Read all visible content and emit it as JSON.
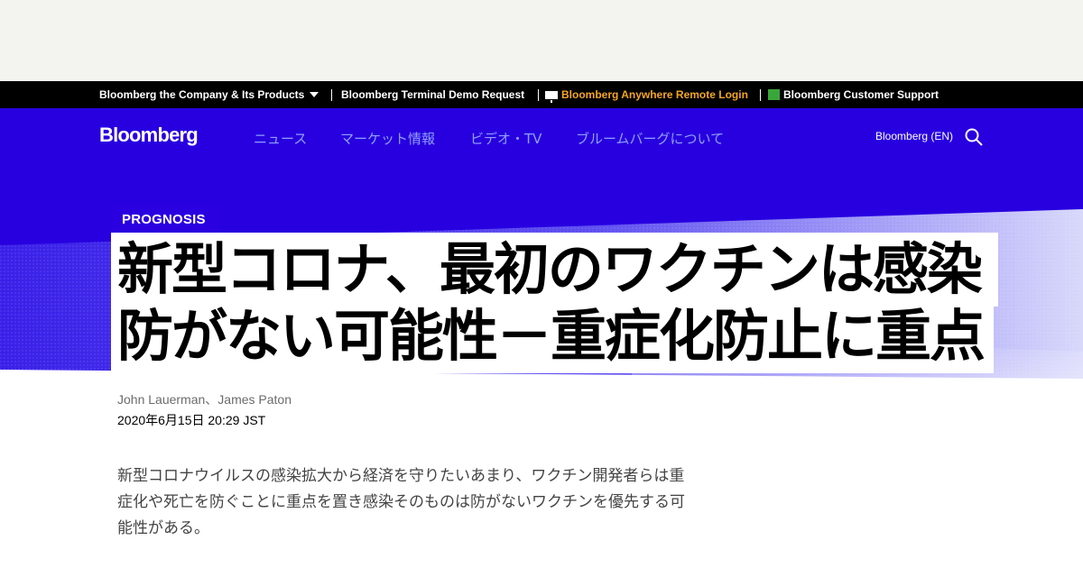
{
  "topbar": {
    "company_products": "Bloomberg the Company & Its Products",
    "terminal_demo": "Bloomberg Terminal Demo Request",
    "anywhere_login": "Bloomberg Anywhere Remote Login",
    "customer_support": "Bloomberg Customer Support"
  },
  "header": {
    "logo": "Bloomberg",
    "nav": [
      "ニュース",
      "マーケット情報",
      "ビデオ・TV",
      "ブルームバーグについて"
    ],
    "edition": "Bloomberg (EN)"
  },
  "article": {
    "kicker": "PROGNOSIS",
    "headline_line1": "新型コロナ、最初のワクチンは感染",
    "headline_line2": "防がない可能性－重症化防止に重点",
    "authors": "John Lauerman、James Paton",
    "timestamp": "2020年6月15日 20:29 JST",
    "summary": "新型コロナウイルスの感染拡大から経済を守りたいあまり、ワクチン開発者らは重症化や死亡を防ぐことに重点を置き感染そのものは防がないワクチンを優先する可能性がある。"
  },
  "colors": {
    "brand_blue": "#2800e0",
    "anywhere_orange": "#f5a623",
    "support_green": "#3aa63a",
    "nav_link": "#8fa0ff"
  },
  "icons": {
    "caret": "chevron-down-icon",
    "terminal": "terminal-icon",
    "support": "support-icon",
    "search": "search-icon"
  }
}
